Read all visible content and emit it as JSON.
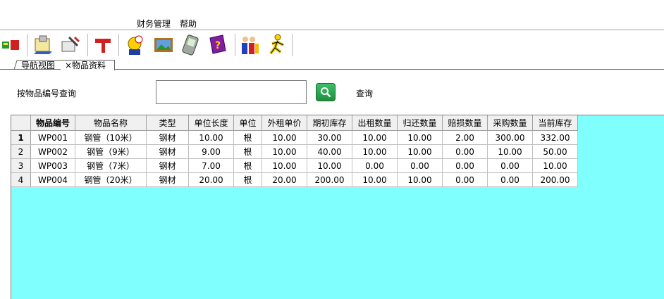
{
  "menu": {
    "finance": "财务管理",
    "help": "帮助"
  },
  "toolbar": {
    "icons": [
      "traffic-light-icon",
      "notepad-icon",
      "tools-icon",
      "hammer-icon",
      "clock-user-icon",
      "picture-icon",
      "handheld-icon",
      "help-book-icon",
      "group-users-icon",
      "runner-icon"
    ]
  },
  "tabs": [
    {
      "label": "导航视图"
    },
    {
      "label": "×物品资料"
    }
  ],
  "query": {
    "label": "按物品编号查询",
    "value": "",
    "button_text": "查询"
  },
  "grid": {
    "columns": [
      "物品编号",
      "物品名称",
      "类型",
      "单位长度",
      "单位",
      "外租单价",
      "期初库存",
      "出租数量",
      "归还数量",
      "赔损数量",
      "采购数量",
      "当前库存"
    ],
    "rows": [
      {
        "n": "1",
        "cells": [
          "WP001",
          "钢管（10米）",
          "钢材",
          "10.00",
          "根",
          "10.00",
          "30.00",
          "10.00",
          "10.00",
          "2.00",
          "300.00",
          "332.00"
        ]
      },
      {
        "n": "2",
        "cells": [
          "WP002",
          "钢管（9米）",
          "钢材",
          "9.00",
          "根",
          "10.00",
          "40.00",
          "10.00",
          "10.00",
          "0.00",
          "10.00",
          "50.00"
        ]
      },
      {
        "n": "3",
        "cells": [
          "WP003",
          "钢管（7米）",
          "钢材",
          "7.00",
          "根",
          "10.00",
          "10.00",
          "0.00",
          "0.00",
          "0.00",
          "0.00",
          "10.00"
        ]
      },
      {
        "n": "4",
        "cells": [
          "WP004",
          "钢管（20米）",
          "钢材",
          "20.00",
          "根",
          "20.00",
          "200.00",
          "10.00",
          "10.00",
          "0.00",
          "0.00",
          "200.00"
        ]
      }
    ]
  },
  "colors": {
    "grid_background": "#80ffff",
    "search_button": "#2aa34f"
  }
}
